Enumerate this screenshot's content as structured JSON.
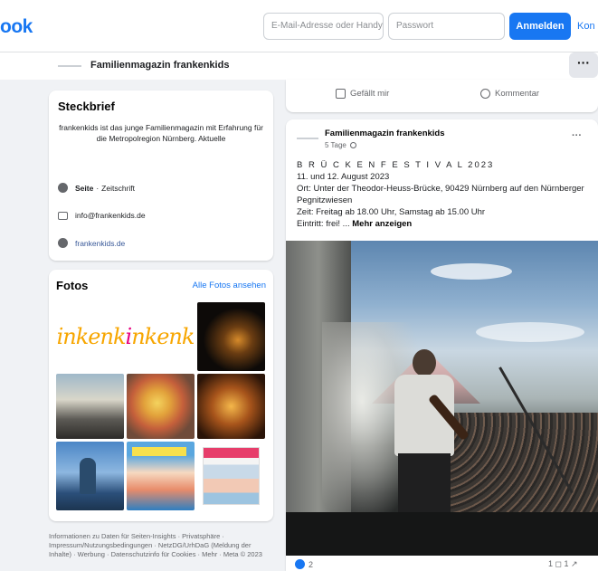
{
  "topbar": {
    "logo": "ook",
    "email_placeholder": "E-Mail-Adresse oder Handynummer",
    "password_placeholder": "Passwort",
    "login_label": "Anmelden",
    "create_label": "Kon"
  },
  "pagebar": {
    "page_name": "Familienmagazin frankenkids",
    "more_label": "···"
  },
  "about": {
    "title": "Steckbrief",
    "description": "frankenkids ist das junge Familienmagazin mit Erfahrung für die Metropolregion Nürnberg. Aktuelle",
    "category_prefix": "Seite",
    "category_sep": "·",
    "category": "Zeitschrift",
    "email": "info@frankenkids.de",
    "website": "frankenkids.de"
  },
  "photos": {
    "title": "Fotos",
    "all_link": "Alle Fotos ansehen",
    "logo_word_a": "inkenk",
    "logo_word_b": "i",
    "logo_word_c": "nkenk"
  },
  "footer": {
    "text": "Informationen zu Daten für Seiten-Insights · Privatsphäre · Impressum/Nutzungsbedingungen · NetzDG/UrhDaG (Meldung der Inhalte) · Werbung · Datenschutzinfo für Cookies · Mehr · Meta © 2023"
  },
  "actions": {
    "like_label": "Gefällt mir",
    "comment_label": "Kommentar"
  },
  "post": {
    "author": "Familienmagazin frankenkids",
    "time": "5 Tage",
    "more_label": "···",
    "line1": "B R Ü C K E N F E S T I V A L 2023",
    "line2": "11. und 12. August 2023",
    "line3": "Ort: Unter der Theodor-Heuss-Brücke, 90429 Nürnberg auf den Nürnberger Pegnitzwiesen",
    "line4": "Zeit: Freitag ab 18.00 Uhr, Samstag ab 15.00 Uhr",
    "line5": "Eintritt: frei! ...",
    "more_link": "Mehr anzeigen",
    "reactions_count": "2",
    "right_stats": "1 ◻  1 ↗"
  },
  "colors": {
    "brand": "#1877f2",
    "background": "#f0f2f5"
  }
}
